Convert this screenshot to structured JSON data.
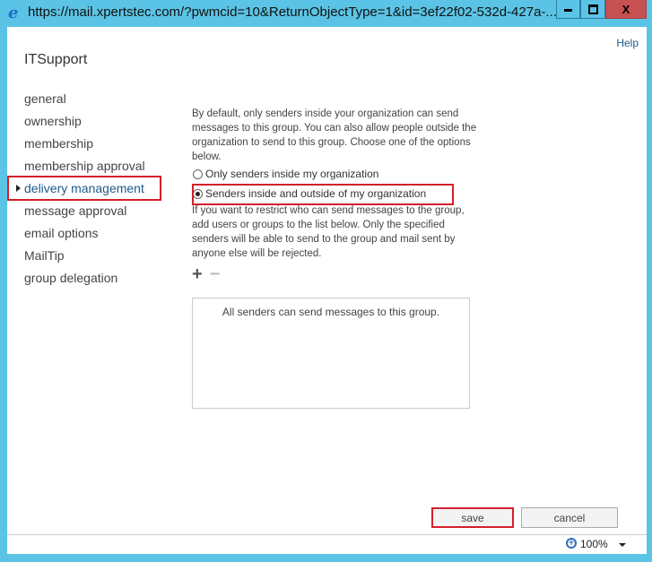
{
  "window": {
    "title": "https://mail.xpertstec.com/?pwmcid=10&ReturnObjectType=1&id=3ef22f02-532d-427a-...",
    "icon": "ie-icon",
    "controls": {
      "minimize": "minimize",
      "maximize": "maximize",
      "close": "X"
    }
  },
  "header": {
    "help_label": "Help",
    "group_name": "ITSupport"
  },
  "nav": {
    "items": [
      {
        "label": "general",
        "active": false
      },
      {
        "label": "ownership",
        "active": false
      },
      {
        "label": "membership",
        "active": false
      },
      {
        "label": "membership approval",
        "active": false
      },
      {
        "label": "delivery management",
        "active": true
      },
      {
        "label": "message approval",
        "active": false
      },
      {
        "label": "email options",
        "active": false
      },
      {
        "label": "MailTip",
        "active": false
      },
      {
        "label": "group delegation",
        "active": false
      }
    ]
  },
  "delivery": {
    "intro": "By default, only senders inside your organization can send messages to this group. You can also allow people outside the organization to send to this group. Choose one of the options below.",
    "options": [
      {
        "label": "Only senders inside my organization",
        "checked": false
      },
      {
        "label": "Senders inside and outside of my organization",
        "checked": true
      }
    ],
    "restrict_text": "If you want to restrict who can send messages to the group, add users or groups to the list below. Only the specified senders will be able to send to the group and mail sent by anyone else will be rejected.",
    "add_icon": "+",
    "remove_icon": "−",
    "list_empty_text": "All senders can send messages to this group."
  },
  "actions": {
    "save_label": "save",
    "cancel_label": "cancel"
  },
  "status": {
    "zoom": "100%"
  },
  "colors": {
    "accent": "#1e5a8a",
    "highlight": "#d3202c",
    "frame": "#5bc4e6"
  }
}
